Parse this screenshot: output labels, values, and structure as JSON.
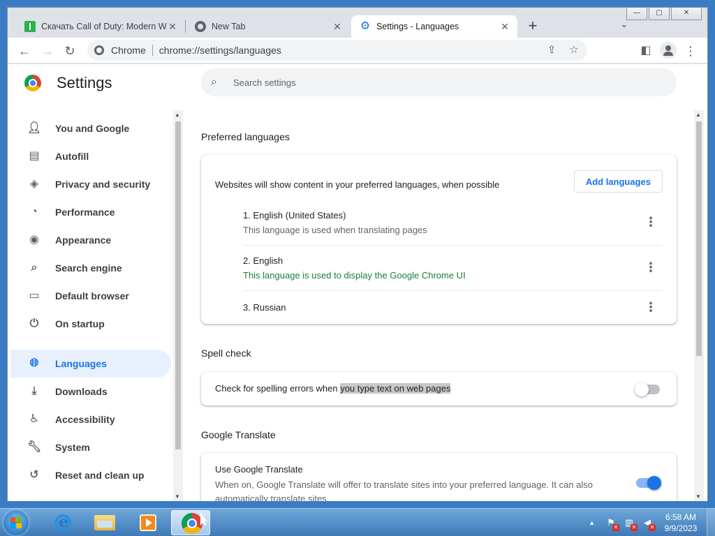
{
  "browser": {
    "tabs": [
      {
        "title": "Скачать Call of Duty: Modern Wa",
        "close": "✕"
      },
      {
        "title": "New Tab",
        "close": "✕"
      },
      {
        "title": "Settings - Languages",
        "close": "✕"
      }
    ],
    "new_tab": "+",
    "tab_search": "⌄",
    "window_controls": {
      "minimize": "—",
      "maximize": "▢",
      "close": "✕"
    },
    "omnibox": {
      "chip": "Chrome",
      "url": "chrome://settings/languages"
    }
  },
  "settings": {
    "title": "Settings",
    "search_placeholder": "Search settings",
    "nav": [
      {
        "label": "You and Google",
        "icon": "person-icon"
      },
      {
        "label": "Autofill",
        "icon": "clipboard-icon"
      },
      {
        "label": "Privacy and security",
        "icon": "shield-icon"
      },
      {
        "label": "Performance",
        "icon": "gauge-icon"
      },
      {
        "label": "Appearance",
        "icon": "palette-icon"
      },
      {
        "label": "Search engine",
        "icon": "search-icon"
      },
      {
        "label": "Default browser",
        "icon": "browser-icon"
      },
      {
        "label": "On startup",
        "icon": "power-icon"
      },
      {
        "label": "Languages",
        "icon": "globe-icon",
        "selected": true
      },
      {
        "label": "Downloads",
        "icon": "download-icon"
      },
      {
        "label": "Accessibility",
        "icon": "accessibility-icon"
      },
      {
        "label": "System",
        "icon": "wrench-icon"
      },
      {
        "label": "Reset and clean up",
        "icon": "history-icon"
      }
    ],
    "preferred_languages": {
      "section_title": "Preferred languages",
      "description": "Websites will show content in your preferred languages, when possible",
      "add_button": "Add languages",
      "languages": [
        {
          "name": "1. English (United States)",
          "note": "This language is used when translating pages"
        },
        {
          "name": "2. English",
          "note": "This language is used to display the Google Chrome UI"
        },
        {
          "name": "3. Russian",
          "note": ""
        }
      ]
    },
    "spell_check": {
      "section_title": "Spell check",
      "label_plain": "Check for spelling errors when ",
      "label_highlight": "you type text on web pages",
      "enabled": false
    },
    "google_translate": {
      "section_title": "Google Translate",
      "title": "Use Google Translate",
      "description": "When on, Google Translate will offer to translate sites into your preferred language. It can also automatically translate sites.",
      "enabled": true
    }
  },
  "taskbar": {
    "clock_time": "6:58 AM",
    "clock_date": "9/9/2023",
    "tray_arrow": "▲"
  },
  "colors": {
    "accent": "#1a73e8",
    "selected_nav_bg": "#e8f0fe",
    "ui_language_note": "#188038",
    "taskbar": "#3f7ab8"
  }
}
